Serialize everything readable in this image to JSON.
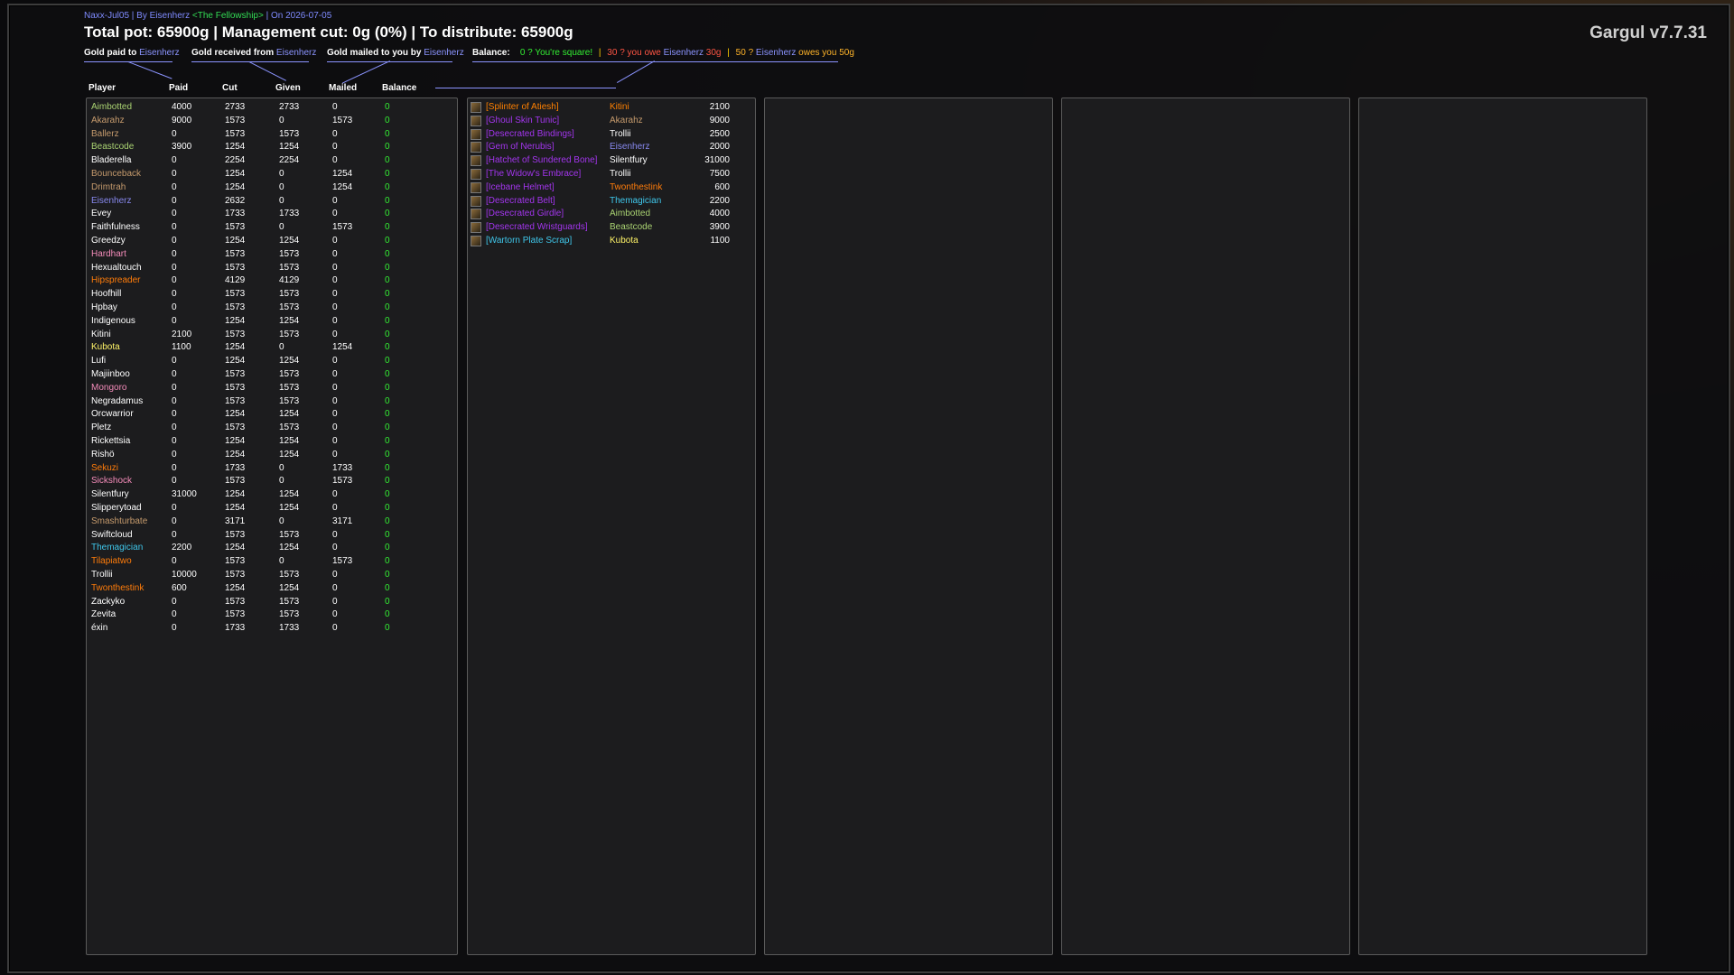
{
  "header": {
    "meta_raid": "Naxx-Jul05",
    "meta_by": " | By Eisenherz ",
    "meta_guild": "<The Fellowship>",
    "meta_date": " | On 2026-07-05",
    "title": "Total pot: 65900g | Management cut: 0g (0%) | To distribute: 65900g",
    "brand": "Gargul v7.7.31"
  },
  "subheaders": {
    "paid_label": "Gold paid to ",
    "received_label": "Gold received from ",
    "mailed_label": "Gold mailed to you by ",
    "name": "Eisenherz",
    "balance_label": "Balance:",
    "bal_square": "0 ? You're square!",
    "bal_owe_a": "30 ? you owe ",
    "bal_owe_b": " 30g",
    "bal_owes_a": "50 ? ",
    "bal_owes_b": " owes you 50g",
    "sep": "|"
  },
  "columns": {
    "player": "Player",
    "paid": "Paid",
    "cut": "Cut",
    "given": "Given",
    "mailed": "Mailed",
    "balance": "Balance"
  },
  "colors": {
    "warrior": "#c69b6d",
    "druid": "#ff7c0a",
    "paladin": "#f48cba",
    "hunter": "#aad372",
    "mage": "#3fc7eb",
    "warlock": "#8788ee",
    "rogue": "#fff468",
    "priest": "#ffffff",
    "legendary": "#ff8000",
    "epic": "#a335ee",
    "rare": "#0070dd",
    "balance_ok": "#33ee33",
    "accent": "#8b94ff"
  },
  "players": [
    {
      "name": "Aimbotted",
      "paid": "4000",
      "cut": "2733",
      "given": "2733",
      "mailed": "0",
      "balance": "0",
      "color": "#aad372"
    },
    {
      "name": "Akarahz",
      "paid": "9000",
      "cut": "1573",
      "given": "0",
      "mailed": "1573",
      "balance": "0",
      "color": "#c69b6d"
    },
    {
      "name": "Ballerz",
      "paid": "0",
      "cut": "1573",
      "given": "1573",
      "mailed": "0",
      "balance": "0",
      "color": "#c69b6d"
    },
    {
      "name": "Beastcode",
      "paid": "3900",
      "cut": "1254",
      "given": "1254",
      "mailed": "0",
      "balance": "0",
      "color": "#aad372"
    },
    {
      "name": "Bladerella",
      "paid": "0",
      "cut": "2254",
      "given": "2254",
      "mailed": "0",
      "balance": "0",
      "color": "#ffffff"
    },
    {
      "name": "Bounceback",
      "paid": "0",
      "cut": "1254",
      "given": "0",
      "mailed": "1254",
      "balance": "0",
      "color": "#c69b6d"
    },
    {
      "name": "Drimtrah",
      "paid": "0",
      "cut": "1254",
      "given": "0",
      "mailed": "1254",
      "balance": "0",
      "color": "#c69b6d"
    },
    {
      "name": "Eisenherz",
      "paid": "0",
      "cut": "2632",
      "given": "0",
      "mailed": "0",
      "balance": "0",
      "color": "#8788ee"
    },
    {
      "name": "Evey",
      "paid": "0",
      "cut": "1733",
      "given": "1733",
      "mailed": "0",
      "balance": "0",
      "color": "#ffffff"
    },
    {
      "name": "Faithfulness",
      "paid": "0",
      "cut": "1573",
      "given": "0",
      "mailed": "1573",
      "balance": "0",
      "color": "#ffffff"
    },
    {
      "name": "Greedzy",
      "paid": "0",
      "cut": "1254",
      "given": "1254",
      "mailed": "0",
      "balance": "0",
      "color": "#ffffff"
    },
    {
      "name": "Hardhart",
      "paid": "0",
      "cut": "1573",
      "given": "1573",
      "mailed": "0",
      "balance": "0",
      "color": "#f48cba"
    },
    {
      "name": "Hexualtouch",
      "paid": "0",
      "cut": "1573",
      "given": "1573",
      "mailed": "0",
      "balance": "0",
      "color": "#ffffff"
    },
    {
      "name": "Hipspreader",
      "paid": "0",
      "cut": "4129",
      "given": "4129",
      "mailed": "0",
      "balance": "0",
      "color": "#ff7c0a"
    },
    {
      "name": "Hoofhill",
      "paid": "0",
      "cut": "1573",
      "given": "1573",
      "mailed": "0",
      "balance": "0",
      "color": "#ffffff"
    },
    {
      "name": "Hpbay",
      "paid": "0",
      "cut": "1573",
      "given": "1573",
      "mailed": "0",
      "balance": "0",
      "color": "#ffffff"
    },
    {
      "name": "Indigenous",
      "paid": "0",
      "cut": "1254",
      "given": "1254",
      "mailed": "0",
      "balance": "0",
      "color": "#ffffff"
    },
    {
      "name": "Kitini",
      "paid": "2100",
      "cut": "1573",
      "given": "1573",
      "mailed": "0",
      "balance": "0",
      "color": "#ffffff"
    },
    {
      "name": "Kubota",
      "paid": "1100",
      "cut": "1254",
      "given": "0",
      "mailed": "1254",
      "balance": "0",
      "color": "#fff468"
    },
    {
      "name": "Lufi",
      "paid": "0",
      "cut": "1254",
      "given": "1254",
      "mailed": "0",
      "balance": "0",
      "color": "#ffffff"
    },
    {
      "name": "Majiinboo",
      "paid": "0",
      "cut": "1573",
      "given": "1573",
      "mailed": "0",
      "balance": "0",
      "color": "#ffffff"
    },
    {
      "name": "Mongoro",
      "paid": "0",
      "cut": "1573",
      "given": "1573",
      "mailed": "0",
      "balance": "0",
      "color": "#f48cba"
    },
    {
      "name": "Negradamus",
      "paid": "0",
      "cut": "1573",
      "given": "1573",
      "mailed": "0",
      "balance": "0",
      "color": "#ffffff"
    },
    {
      "name": "Orcwarrior",
      "paid": "0",
      "cut": "1254",
      "given": "1254",
      "mailed": "0",
      "balance": "0",
      "color": "#ffffff"
    },
    {
      "name": "Pletz",
      "paid": "0",
      "cut": "1573",
      "given": "1573",
      "mailed": "0",
      "balance": "0",
      "color": "#ffffff"
    },
    {
      "name": "Rickettsia",
      "paid": "0",
      "cut": "1254",
      "given": "1254",
      "mailed": "0",
      "balance": "0",
      "color": "#ffffff"
    },
    {
      "name": "Rishö",
      "paid": "0",
      "cut": "1254",
      "given": "1254",
      "mailed": "0",
      "balance": "0",
      "color": "#ffffff"
    },
    {
      "name": "Sekuzi",
      "paid": "0",
      "cut": "1733",
      "given": "0",
      "mailed": "1733",
      "balance": "0",
      "color": "#ff7c0a"
    },
    {
      "name": "Sickshock",
      "paid": "0",
      "cut": "1573",
      "given": "0",
      "mailed": "1573",
      "balance": "0",
      "color": "#f48cba"
    },
    {
      "name": "Silentfury",
      "paid": "31000",
      "cut": "1254",
      "given": "1254",
      "mailed": "0",
      "balance": "0",
      "color": "#ffffff"
    },
    {
      "name": "Slipperytoad",
      "paid": "0",
      "cut": "1254",
      "given": "1254",
      "mailed": "0",
      "balance": "0",
      "color": "#ffffff"
    },
    {
      "name": "Smashturbate",
      "paid": "0",
      "cut": "3171",
      "given": "0",
      "mailed": "3171",
      "balance": "0",
      "color": "#c69b6d"
    },
    {
      "name": "Swiftcloud",
      "paid": "0",
      "cut": "1573",
      "given": "1573",
      "mailed": "0",
      "balance": "0",
      "color": "#ffffff"
    },
    {
      "name": "Themagician",
      "paid": "2200",
      "cut": "1254",
      "given": "1254",
      "mailed": "0",
      "balance": "0",
      "color": "#3fc7eb"
    },
    {
      "name": "Tilapiatwo",
      "paid": "0",
      "cut": "1573",
      "given": "0",
      "mailed": "1573",
      "balance": "0",
      "color": "#ff7c0a"
    },
    {
      "name": "Trollii",
      "paid": "10000",
      "cut": "1573",
      "given": "1573",
      "mailed": "0",
      "balance": "0",
      "color": "#ffffff"
    },
    {
      "name": "Twonthestink",
      "paid": "600",
      "cut": "1254",
      "given": "1254",
      "mailed": "0",
      "balance": "0",
      "color": "#ff7c0a"
    },
    {
      "name": "Zackyko",
      "paid": "0",
      "cut": "1573",
      "given": "1573",
      "mailed": "0",
      "balance": "0",
      "color": "#ffffff"
    },
    {
      "name": "Zevita",
      "paid": "0",
      "cut": "1573",
      "given": "1573",
      "mailed": "0",
      "balance": "0",
      "color": "#ffffff"
    },
    {
      "name": "éxin",
      "paid": "0",
      "cut": "1733",
      "given": "1733",
      "mailed": "0",
      "balance": "0",
      "color": "#ffffff"
    }
  ],
  "items": [
    {
      "item": "[Splinter of Atiesh]",
      "winner": "Kitini",
      "price": "2100",
      "item_color": "#ff8000",
      "winner_color": "#ff8000",
      "icon": "splinter-icon"
    },
    {
      "item": "[Ghoul Skin Tunic]",
      "winner": "Akarahz",
      "price": "9000",
      "item_color": "#a335ee",
      "winner_color": "#c69b6d",
      "icon": "tunic-icon"
    },
    {
      "item": "[Desecrated Bindings]",
      "winner": "Trollii",
      "price": "2500",
      "item_color": "#a335ee",
      "winner_color": "#ffffff",
      "icon": "bindings-icon"
    },
    {
      "item": "[Gem of Nerubis]",
      "winner": "Eisenherz",
      "price": "2000",
      "item_color": "#a335ee",
      "winner_color": "#8788ee",
      "icon": "gem-icon"
    },
    {
      "item": "[Hatchet of Sundered Bone]",
      "winner": "Silentfury",
      "price": "31000",
      "item_color": "#a335ee",
      "winner_color": "#ffffff",
      "icon": "hatchet-icon"
    },
    {
      "item": "[The Widow's Embrace]",
      "winner": "Trollii",
      "price": "7500",
      "item_color": "#a335ee",
      "winner_color": "#ffffff",
      "icon": "embrace-icon"
    },
    {
      "item": "[Icebane Helmet]",
      "winner": "Twonthestink",
      "price": "600",
      "item_color": "#a335ee",
      "winner_color": "#ff7c0a",
      "icon": "helmet-icon"
    },
    {
      "item": "[Desecrated Belt]",
      "winner": "Themagician",
      "price": "2200",
      "item_color": "#a335ee",
      "winner_color": "#3fc7eb",
      "icon": "belt-icon"
    },
    {
      "item": "[Desecrated Girdle]",
      "winner": "Aimbotted",
      "price": "4000",
      "item_color": "#a335ee",
      "winner_color": "#aad372",
      "icon": "girdle-icon"
    },
    {
      "item": "[Desecrated Wristguards]",
      "winner": "Beastcode",
      "price": "3900",
      "item_color": "#a335ee",
      "winner_color": "#aad372",
      "icon": "wristguards-icon"
    },
    {
      "item": "[Wartorn Plate Scrap]",
      "winner": "Kubota",
      "price": "1100",
      "item_color": "#3fc7eb",
      "winner_color": "#fff468",
      "icon": "scrap-icon"
    }
  ]
}
